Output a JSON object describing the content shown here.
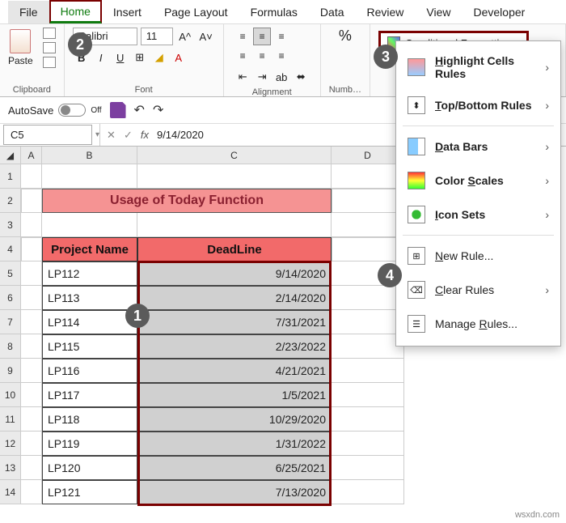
{
  "tabs": [
    "File",
    "Home",
    "Insert",
    "Page Layout",
    "Formulas",
    "Data",
    "Review",
    "View",
    "Developer"
  ],
  "active_tab": "Home",
  "ribbon": {
    "clipboard": {
      "paste": "Paste",
      "label": "Clipboard"
    },
    "font": {
      "name": "Calibri",
      "size": "11",
      "label": "Font"
    },
    "alignment": {
      "label": "Alignment",
      "wrap": "ab"
    },
    "number": {
      "label": "Numb…",
      "percent": "%"
    },
    "cf_label": "Conditional Formatting"
  },
  "qat": {
    "autosave": "AutoSave",
    "state": "Off"
  },
  "namebox": "C5",
  "formula": "9/14/2020",
  "columns": [
    "A",
    "B",
    "C",
    "D"
  ],
  "rows_head": [
    "1",
    "2",
    "3",
    "4",
    "5",
    "6",
    "7",
    "8",
    "9",
    "10",
    "11",
    "12",
    "13",
    "14"
  ],
  "title": "Usage of Today Function",
  "headers": {
    "b": "Project Name",
    "c": "DeadLine"
  },
  "data_rows": [
    {
      "b": "LP112",
      "c": "9/14/2020"
    },
    {
      "b": "LP113",
      "c": "2/14/2020"
    },
    {
      "b": "LP114",
      "c": "7/31/2021"
    },
    {
      "b": "LP115",
      "c": "2/23/2022"
    },
    {
      "b": "LP116",
      "c": "4/21/2021"
    },
    {
      "b": "LP117",
      "c": "1/5/2021"
    },
    {
      "b": "LP118",
      "c": "10/29/2020"
    },
    {
      "b": "LP119",
      "c": "1/31/2022"
    },
    {
      "b": "LP120",
      "c": "6/25/2021"
    },
    {
      "b": "LP121",
      "c": "7/13/2020"
    }
  ],
  "menu": {
    "highlight": "Highlight Cells Rules",
    "topbottom": "Top/Bottom Rules",
    "databars": "Data Bars",
    "colorscales": "Color Scales",
    "iconsets": "Icon Sets",
    "newrule": "New Rule...",
    "clear": "Clear Rules",
    "manage": "Manage Rules..."
  },
  "callouts": {
    "1": "1",
    "2": "2",
    "3": "3",
    "4": "4"
  },
  "watermark": "wsxdn.com"
}
